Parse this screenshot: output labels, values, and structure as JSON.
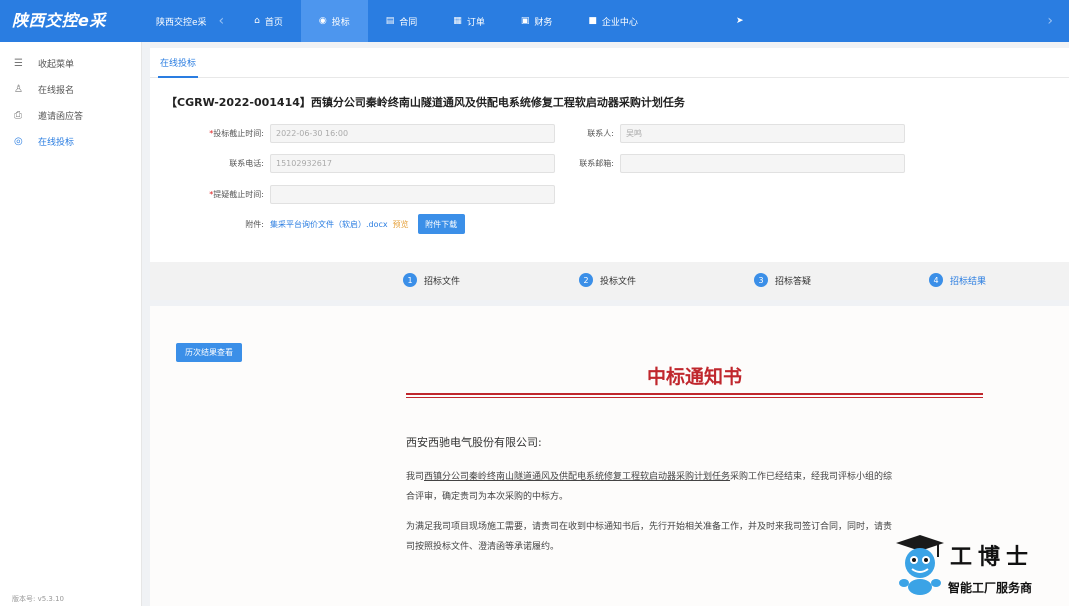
{
  "app": {
    "brand": "陕西交控e采",
    "brand_sub": "陕西交控e采",
    "version": "版本号: v5.3.10"
  },
  "nav": {
    "items": [
      {
        "label": "首页",
        "icon": "home-icon"
      },
      {
        "label": "投标",
        "icon": "bid-icon"
      },
      {
        "label": "合同",
        "icon": "contract-icon"
      },
      {
        "label": "订单",
        "icon": "order-icon"
      },
      {
        "label": "财务",
        "icon": "finance-icon"
      },
      {
        "label": "企业中心",
        "icon": "enterprise-icon"
      }
    ],
    "active": "投标"
  },
  "sidebar": {
    "items": [
      {
        "label": "收起菜单",
        "icon": "collapse-menu-icon"
      },
      {
        "label": "在线报名",
        "icon": "user-icon"
      },
      {
        "label": "邀请函应答",
        "icon": "printer-icon"
      },
      {
        "label": "在线投标",
        "icon": "target-icon"
      }
    ],
    "active": "在线投标"
  },
  "tabs": {
    "current": "在线投标"
  },
  "project": {
    "title": "【CGRW-2022-001414】西镇分公司秦岭终南山隧道通风及供配电系统修复工程软启动器采购计划任务"
  },
  "form": {
    "deadline_label": "投标截止时间:",
    "deadline_value": "2022-06-30 16:00",
    "contact_label": "联系人:",
    "contact_value": "吴鸣",
    "phone_label": "联系电话:",
    "phone_value": "15102932617",
    "email_label": "联系邮箱:",
    "email_value": "",
    "question_label": "提疑截止时间:",
    "question_value": "",
    "attachment_label": "附件:",
    "attachment_file": "集采平台询价文件（软启）.docx",
    "attachment_preview": "预览",
    "attachment_download": "附件下载",
    "required_mark": "*"
  },
  "steps": [
    {
      "num": "1",
      "label": "招标文件"
    },
    {
      "num": "2",
      "label": "投标文件"
    },
    {
      "num": "3",
      "label": "招标答疑"
    },
    {
      "num": "4",
      "label": "招标结果"
    }
  ],
  "notice": {
    "history_button": "历次结果查看",
    "title": "中标通知书",
    "recipient": "西安西驰电气股份有限公司:",
    "para1_prefix": "我司",
    "para1_project": "西镇分公司秦岭终南山隧道通风及供配电系统修复工程软启动器采购计划任务",
    "para1_line1_rest": "采购工作已经结束，经我司评标小组的综",
    "para1_line2": "合评审，确定贵司为本次采购的中标方。",
    "para2_line1": "为满足我司项目现场施工需要，请贵司在收到中标通知书后，先行开始相关准备工作，并及时来我司签订合同，同时，请贵",
    "para2_line2": "司按照投标文件、澄清函等承诺履约。"
  },
  "watermark": {
    "big": "工博士",
    "small": "智能工厂服务商"
  },
  "colors": {
    "topbar": "#2a7de1",
    "nav_active": "#4d96ee",
    "accent": "#2a7de1",
    "notice_red": "#c0272d",
    "preview_orange": "#e6a23c"
  }
}
